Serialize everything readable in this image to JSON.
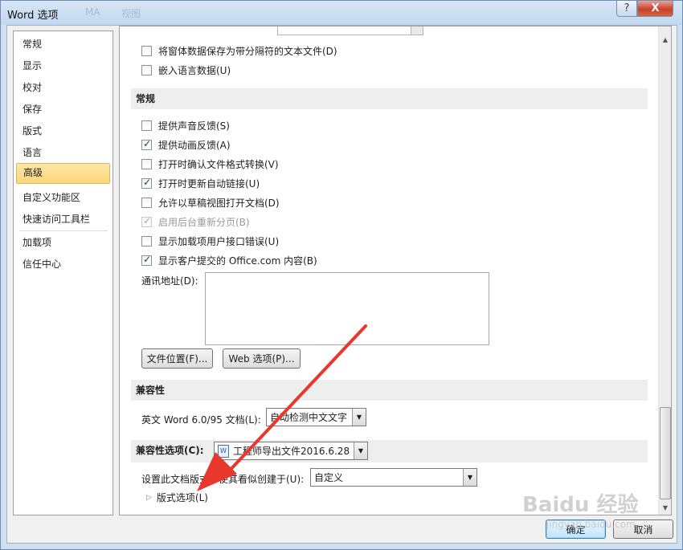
{
  "window": {
    "title": "Word 选项",
    "ghost_title_1": "MA",
    "ghost_title_2": "视图",
    "help_glyph": "?",
    "close_glyph": "X"
  },
  "nav": {
    "items": [
      {
        "label": "常规"
      },
      {
        "label": "显示"
      },
      {
        "label": "校对"
      },
      {
        "label": "保存"
      },
      {
        "label": "版式"
      },
      {
        "label": "语言"
      },
      {
        "label": "高级",
        "selected": true
      },
      {
        "label": "自定义功能区"
      },
      {
        "label": "快速访问工具栏"
      },
      {
        "label": "加载项"
      },
      {
        "label": "信任中心"
      }
    ]
  },
  "content": {
    "top_options": [
      {
        "label": "将窗体数据保存为带分隔符的文本文件(D)",
        "checked": false
      },
      {
        "label": "嵌入语言数据(U)",
        "checked": false
      }
    ],
    "general_section": {
      "title": "常规",
      "options": [
        {
          "label": "提供声音反馈(S)",
          "checked": false,
          "disabled": false
        },
        {
          "label": "提供动画反馈(A)",
          "checked": true,
          "disabled": false
        },
        {
          "label": "打开时确认文件格式转换(V)",
          "checked": false,
          "disabled": false
        },
        {
          "label": "打开时更新自动链接(U)",
          "checked": true,
          "disabled": false
        },
        {
          "label": "允许以草稿视图打开文档(D)",
          "checked": false,
          "disabled": false
        },
        {
          "label": "启用后台重新分页(B)",
          "checked": true,
          "disabled": true
        },
        {
          "label": "显示加载项用户接口错误(U)",
          "checked": false,
          "disabled": false
        },
        {
          "label": "显示客户提交的 Office.com 内容(B)",
          "checked": true,
          "disabled": false
        }
      ],
      "mailing_address_label": "通讯地址(D):",
      "mailing_address_value": "",
      "file_locations_button": "文件位置(F)...",
      "web_options_button": "Web 选项(P)..."
    },
    "compat_section": {
      "title": "兼容性",
      "english_word_label": "英文 Word 6.0/95 文档(L):",
      "english_word_value": "自动检测中文文字"
    },
    "compat_options_section": {
      "title": "兼容性选项(C):",
      "document_value": "工程师导出文件2016.6.28",
      "doc_icon_glyph": "W",
      "layout_label": "设置此文档版式，使其看似创建于(U):",
      "layout_value": "自定义",
      "expander_label": "版式选项(L)"
    }
  },
  "footer": {
    "ok_button": "确定",
    "cancel_button": "取消"
  },
  "scrollbar": {
    "up_glyph": "▲",
    "down_glyph": "▼"
  },
  "watermark": {
    "brand": "Baidu 经验",
    "url": "jingyan.baidu.com"
  },
  "annotation": {
    "arrow_color": "#e8372c"
  }
}
